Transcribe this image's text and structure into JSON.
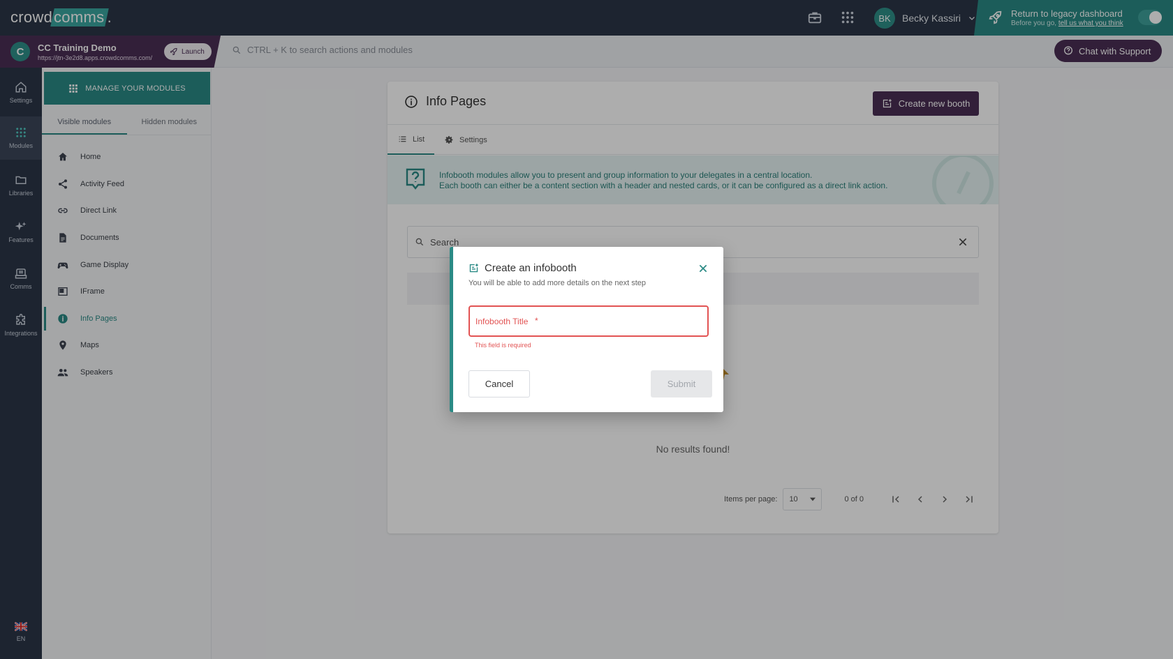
{
  "topbar": {
    "logo_text_a": "crowd",
    "logo_text_b": "comms",
    "user_initials": "BK",
    "user_name": "Becky Kassiri",
    "legacy_title": "Return to legacy dashboard",
    "legacy_sub_prefix": "Before you go,",
    "legacy_link": "tell us what you think"
  },
  "subbar": {
    "event_name": "CC Training Demo",
    "event_url": "https://jtn-3e2d8.apps.crowdcomms.com/",
    "launch_label": "Launch",
    "search_placeholder": "CTRL + K to search actions and modules",
    "support_label": "Chat with Support"
  },
  "rail": {
    "items": [
      {
        "label": "Settings",
        "icon": "home-icon"
      },
      {
        "label": "Modules",
        "icon": "grid-icon"
      },
      {
        "label": "Libraries",
        "icon": "folder-icon"
      },
      {
        "label": "Features",
        "icon": "sparkle-icon"
      },
      {
        "label": "Comms",
        "icon": "inbox-icon"
      },
      {
        "label": "Integrations",
        "icon": "puzzle-icon"
      }
    ],
    "active": "Modules",
    "language": "EN"
  },
  "modules": {
    "manage_label": "MANAGE YOUR MODULES",
    "tabs": [
      "Visible modules",
      "Hidden modules"
    ],
    "items": [
      {
        "label": "Home",
        "icon": "home-icon"
      },
      {
        "label": "Activity Feed",
        "icon": "share-icon"
      },
      {
        "label": "Direct Link",
        "icon": "link-icon"
      },
      {
        "label": "Documents",
        "icon": "document-icon"
      },
      {
        "label": "Game Display",
        "icon": "gamepad-icon"
      },
      {
        "label": "IFrame",
        "icon": "iframe-icon"
      },
      {
        "label": "Info Pages",
        "icon": "info-icon"
      },
      {
        "label": "Maps",
        "icon": "map-pin-icon"
      },
      {
        "label": "Speakers",
        "icon": "people-icon"
      }
    ],
    "active": "Info Pages"
  },
  "page": {
    "title": "Info Pages",
    "create_label": "Create new booth",
    "tabs": [
      "List",
      "Settings"
    ],
    "info_line1": "Infobooth modules allow you to present and group information to your delegates in a central location.",
    "info_line2": "Each booth can either be a content section with a header and nested cards, or it can be configured as a direct link action.",
    "search_placeholder": "Search",
    "no_results": "No results found!",
    "items_per_page_label": "Items per page:",
    "items_per_page_value": "10",
    "range": "0 of 0"
  },
  "modal": {
    "title": "Create an infobooth",
    "subtitle": "You will be able to add more details on the next step",
    "field_placeholder": "Infobooth Title",
    "field_required_mark": "*",
    "error": "This field is required",
    "cancel_label": "Cancel",
    "submit_label": "Submit"
  },
  "colors": {
    "accent": "#2a8a85",
    "brand_purple": "#4b2f55",
    "dark_nav": "#2b3547",
    "error": "#e25353"
  }
}
